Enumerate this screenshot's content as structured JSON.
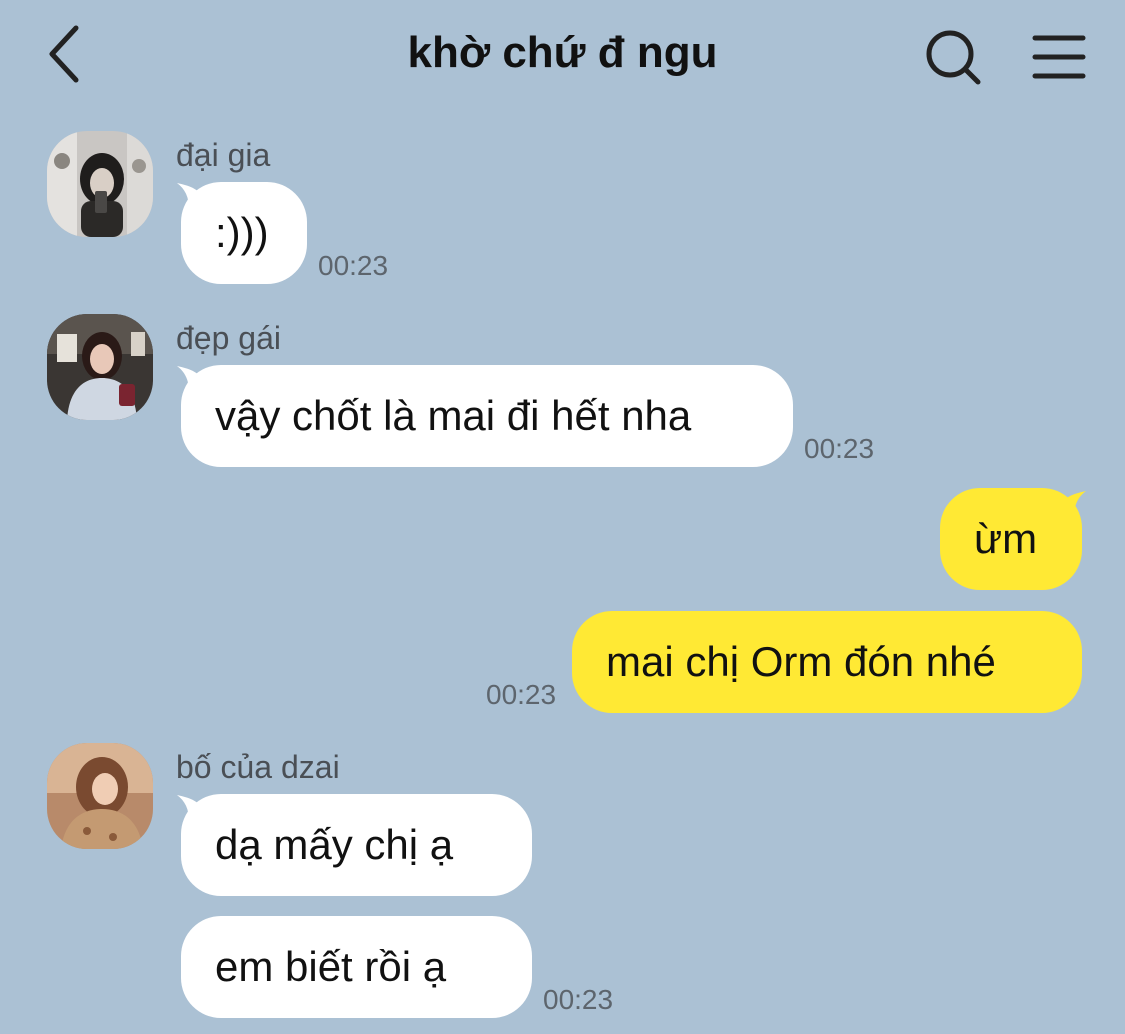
{
  "header": {
    "title": "khờ chứ đ ngu",
    "back_icon": "chevron-left-icon",
    "search_icon": "search-icon",
    "menu_icon": "hamburger-menu-icon"
  },
  "colors": {
    "background": "#abc1d4",
    "incoming_bubble": "#ffffff",
    "outgoing_bubble": "#ffe934",
    "time_text": "#5d656d"
  },
  "messages": [
    {
      "sender": "đại gia",
      "text": ":)))",
      "time": "00:23",
      "direction": "incoming"
    },
    {
      "sender": "đẹp gái",
      "text": "vậy chốt là mai đi hết nha",
      "time": "00:23",
      "direction": "incoming"
    },
    {
      "sender": "",
      "text": "ừm",
      "time": "",
      "direction": "outgoing"
    },
    {
      "sender": "",
      "text": "mai chị Orm đón nhé",
      "time": "00:23",
      "direction": "outgoing"
    },
    {
      "sender": "bố của dzai",
      "text": "dạ mấy chị ạ",
      "time": "",
      "direction": "incoming"
    },
    {
      "sender": "",
      "text": "em biết rồi ạ",
      "time": "00:23",
      "direction": "incoming"
    }
  ]
}
